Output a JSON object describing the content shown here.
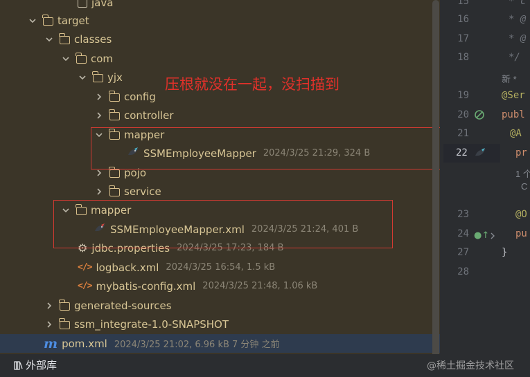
{
  "tree": {
    "rows": [
      {
        "label": "java",
        "meta": ""
      },
      {
        "label": "target",
        "meta": ""
      },
      {
        "label": "classes",
        "meta": ""
      },
      {
        "label": "com",
        "meta": ""
      },
      {
        "label": "yjx",
        "meta": ""
      },
      {
        "label": "config",
        "meta": ""
      },
      {
        "label": "controller",
        "meta": ""
      },
      {
        "label": "mapper",
        "meta": ""
      },
      {
        "label": "SSMEmployeeMapper",
        "meta": "2024/3/25 21:29, 324 B"
      },
      {
        "label": "pojo",
        "meta": ""
      },
      {
        "label": "service",
        "meta": ""
      },
      {
        "label": "mapper",
        "meta": ""
      },
      {
        "label": "SSMEmployeeMapper.xml",
        "meta": "2024/3/25 21:24, 401 B"
      },
      {
        "label": "jdbc.properties",
        "meta": "2024/3/25 17:23, 184 B"
      },
      {
        "label": "logback.xml",
        "meta": "2024/3/25 16:54, 1.5 kB"
      },
      {
        "label": "mybatis-config.xml",
        "meta": "2024/3/25 21:48, 1.06 kB"
      },
      {
        "label": "generated-sources",
        "meta": ""
      },
      {
        "label": "ssm_integrate-1.0-SNAPSHOT",
        "meta": ""
      },
      {
        "label": "pom.xml",
        "meta": "2024/3/25 21:02, 6.96 kB 7 分钟 之前"
      }
    ],
    "external_libraries": "外部库"
  },
  "annotation": {
    "text": "压根就没在一起，没扫描到",
    "color": "#e1312a"
  },
  "editor": {
    "line_numbers": [
      "15",
      "16",
      "17",
      "18",
      "19",
      "20",
      "21",
      "22",
      "23",
      "24",
      "27",
      "28"
    ],
    "code_lines": [
      "* c",
      "* @",
      "* @",
      "*/",
      "新 *",
      "@Ser",
      "publ",
      "@A",
      "pr",
      "1 个",
      "C",
      "@O",
      "pu",
      "}"
    ]
  },
  "watermark": "@稀土掘金技术社区",
  "colors": {
    "folder": "#d9c08c",
    "tree_bg": "#3b3528",
    "red": "#d23a32",
    "selected": "#2e3b4e"
  }
}
